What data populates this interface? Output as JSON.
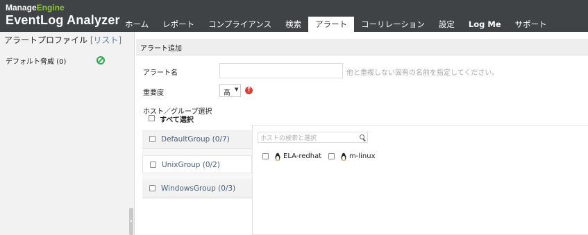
{
  "brand": {
    "top_prefix": "Manage",
    "top_suffix": "Engine",
    "product": "EventLog Analyzer"
  },
  "nav": {
    "items": [
      {
        "label": "ホーム"
      },
      {
        "label": "レポート"
      },
      {
        "label": "コンプライアンス"
      },
      {
        "label": "検索"
      },
      {
        "label": "アラート",
        "active": true
      },
      {
        "label": "コーリレーション"
      },
      {
        "label": "設定"
      },
      {
        "label": "Log Me"
      },
      {
        "label": "サポート"
      }
    ]
  },
  "left_panel": {
    "title": "アラートプロファイル",
    "list_link": "[リスト]",
    "items": [
      {
        "label": "デフォルト脅威 (0)",
        "status_icon": "check-circle-icon",
        "status_color": "#2fa84f"
      }
    ]
  },
  "main": {
    "header": "アラート追加",
    "alert_name_label": "アラート名",
    "alert_name_value": "",
    "alert_name_hint": "他と重複しない固有の名前を指定してください。",
    "severity_label": "重要度",
    "severity_value": "高",
    "severity_icon_color": "#e03c31",
    "host_group_label": "ホスト／グループ選択",
    "select_all_label": "すべて選択",
    "groups": [
      {
        "label": "DefaultGroup (0/7)"
      },
      {
        "label": "UnixGroup (0/2)"
      },
      {
        "label": "WindowsGroup (0/3)"
      }
    ],
    "host_search_placeholder": "ホストの検索と選択",
    "hosts": [
      {
        "label": "ELA-redhat",
        "icon": "linux-icon"
      },
      {
        "label": "m-linux",
        "icon": "linux-icon"
      }
    ]
  },
  "colors": {
    "header_bg": "#3f4346",
    "brand_green": "#8cc63f",
    "link_blue": "#5b7fa8"
  }
}
